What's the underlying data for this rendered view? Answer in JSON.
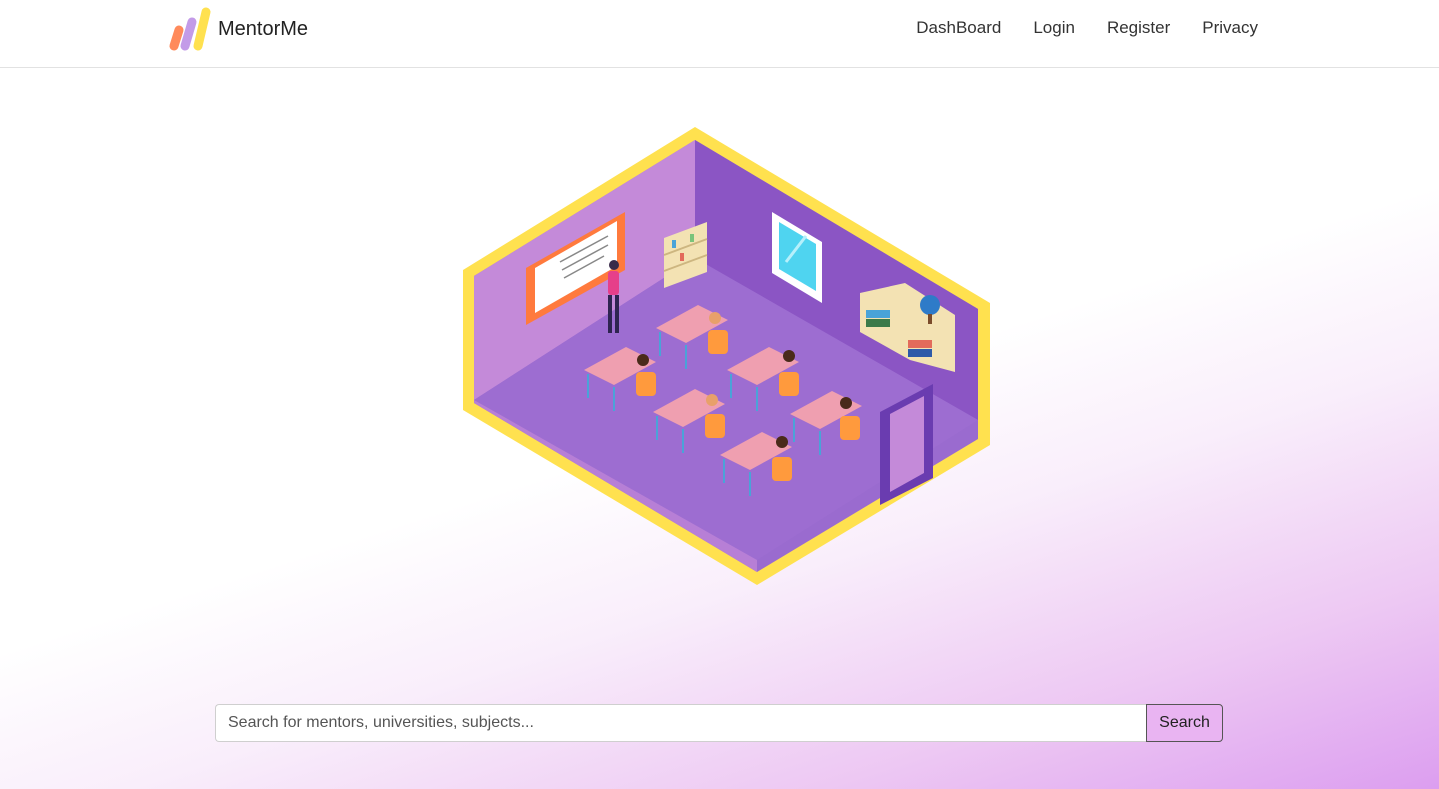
{
  "brand": {
    "name": "MentorMe",
    "logo_icon": "bars-logo-icon"
  },
  "nav": {
    "items": [
      {
        "label": "DashBoard"
      },
      {
        "label": "Login"
      },
      {
        "label": "Register"
      },
      {
        "label": "Privacy"
      }
    ]
  },
  "hero": {
    "illustration": "isometric-classroom-illustration"
  },
  "search": {
    "placeholder": "Search for mentors, universities, subjects...",
    "value": "",
    "button_label": "Search"
  },
  "colors": {
    "frame_yellow": "#ffe14f",
    "room_purple": "#8e5cc9",
    "accent_pink": "#e9b4f2",
    "logo_orange": "#ff8a5b",
    "logo_purple": "#c39be8",
    "logo_yellow": "#ffe14f"
  }
}
